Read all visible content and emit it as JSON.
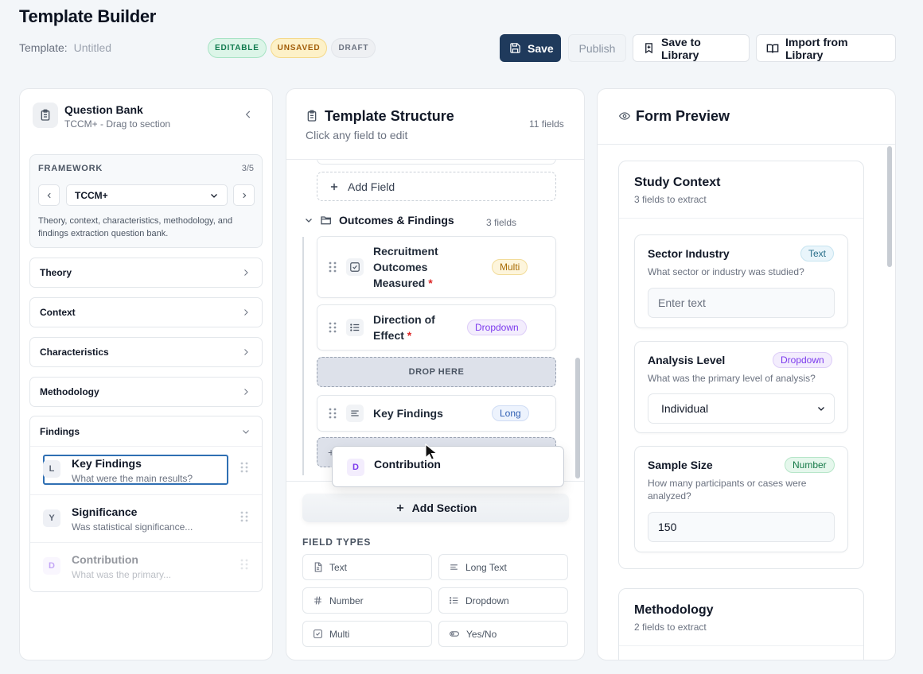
{
  "header": {
    "title": "Template Builder",
    "template_label": "Template:",
    "template_name": "Untitled",
    "badges": {
      "editable": "EDITABLE",
      "unsaved": "UNSAVED",
      "draft": "DRAFT"
    },
    "save": "Save",
    "publish": "Publish",
    "save_library": "Save to Library",
    "import_library": "Import from Library"
  },
  "question_bank": {
    "title": "Question Bank",
    "subtitle": "TCCM+ - Drag to section",
    "framework_label": "FRAMEWORK",
    "framework_count": "3/5",
    "framework_selected": "TCCM+",
    "framework_desc": "Theory, context, characteristics, methodology, and findings extraction question bank.",
    "categories": [
      "Theory",
      "Context",
      "Characteristics",
      "Methodology"
    ],
    "findings": {
      "label": "Findings",
      "items": [
        {
          "letter": "L",
          "title": "Key Findings",
          "sub": "What were the main results?"
        },
        {
          "letter": "Y",
          "title": "Significance",
          "sub": "Was statistical significance..."
        },
        {
          "letter": "D",
          "title": "Contribution",
          "sub": "What was the primary..."
        }
      ]
    }
  },
  "structure": {
    "title": "Template Structure",
    "subtitle": "Click any field to edit",
    "count": "11 fields",
    "add_field": "Add Field",
    "section": {
      "name": "Outcomes & Findings",
      "count": "3 fields"
    },
    "fields": [
      {
        "title": "Recruitment Outcomes Measured",
        "tag": "Multi"
      },
      {
        "title": "Direction of Effect",
        "tag": "Dropdown"
      },
      {
        "title": "Key Findings",
        "tag": "Long"
      }
    ],
    "drop_here": "DROP HERE",
    "dragging": {
      "letter": "D",
      "title": "Contribution"
    },
    "add_section": "Add Section",
    "field_types_label": "FIELD TYPES",
    "field_types": [
      "Text",
      "Long Text",
      "Number",
      "Dropdown",
      "Multi",
      "Yes/No"
    ]
  },
  "preview": {
    "title": "Form Preview",
    "sections": [
      {
        "title": "Study Context",
        "sub": "3 fields to extract",
        "fields": [
          {
            "title": "Sector Industry",
            "tag": "Text",
            "desc": "What sector or industry was studied?",
            "placeholder": "Enter text"
          },
          {
            "title": "Analysis Level",
            "tag": "Dropdown",
            "desc": "What was the primary level of analysis?",
            "value": "Individual"
          },
          {
            "title": "Sample Size",
            "tag": "Number",
            "desc": "How many participants or cases were analyzed?",
            "value": "150"
          }
        ]
      },
      {
        "title": "Methodology",
        "sub": "2 fields to extract"
      }
    ]
  },
  "colors": {
    "primary": "#1f3a5c",
    "accent": "#2f6fb3",
    "required": "#dc2626"
  }
}
